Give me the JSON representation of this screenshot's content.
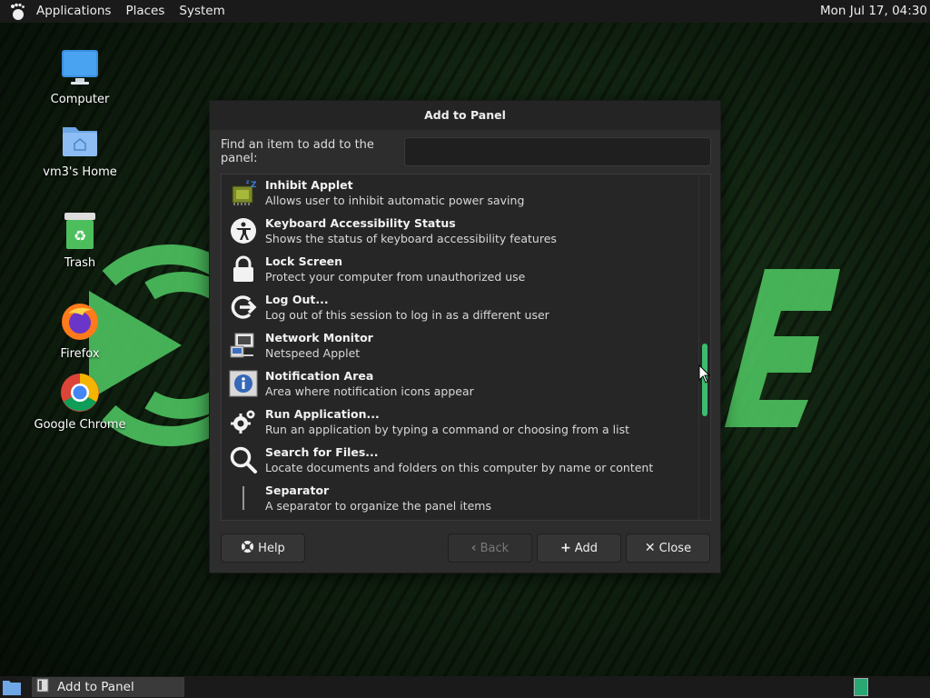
{
  "top_panel": {
    "menus": [
      "Applications",
      "Places",
      "System"
    ],
    "clock": "Mon Jul 17, 04:30",
    "logo_icon": "gnome-foot-icon"
  },
  "desktop": {
    "icons": [
      {
        "label": "Computer",
        "icon": "monitor-icon"
      },
      {
        "label": "vm3's Home",
        "icon": "home-folder-icon"
      },
      {
        "label": "Trash",
        "icon": "trash-icon"
      },
      {
        "label": "Firefox",
        "icon": "firefox-icon"
      },
      {
        "label": "Google Chrome",
        "icon": "chrome-icon"
      }
    ],
    "accent": "#4cc15f"
  },
  "dialog": {
    "title": "Add to Panel",
    "find_label": "Find an item to add to the panel:",
    "find_value": "",
    "items": [
      {
        "name": "Inhibit Applet",
        "desc": "Allows user to inhibit automatic power saving",
        "icon": "inhibit-chip-icon"
      },
      {
        "name": "Keyboard Accessibility Status",
        "desc": "Shows the status of keyboard accessibility features",
        "icon": "accessibility-icon"
      },
      {
        "name": "Lock Screen",
        "desc": "Protect your computer from unauthorized use",
        "icon": "lock-icon"
      },
      {
        "name": "Log Out...",
        "desc": "Log out of this session to log in as a different user",
        "icon": "logout-icon"
      },
      {
        "name": "Network Monitor",
        "desc": "Netspeed Applet",
        "icon": "network-monitor-icon"
      },
      {
        "name": "Notification Area",
        "desc": "Area where notification icons appear",
        "icon": "info-icon"
      },
      {
        "name": "Run Application...",
        "desc": "Run an application by typing a command or choosing from a list",
        "icon": "gears-icon"
      },
      {
        "name": "Search for Files...",
        "desc": "Locate documents and folders on this computer by name or content",
        "icon": "search-icon"
      },
      {
        "name": "Separator",
        "desc": "A separator to organize the panel items",
        "icon": "separator-icon"
      }
    ],
    "buttons": {
      "help": "Help",
      "back": "Back",
      "add": "Add",
      "close": "Close"
    },
    "scroll_accent": "#3dba6f"
  },
  "bottom_panel": {
    "task_label": "Add to Panel"
  }
}
